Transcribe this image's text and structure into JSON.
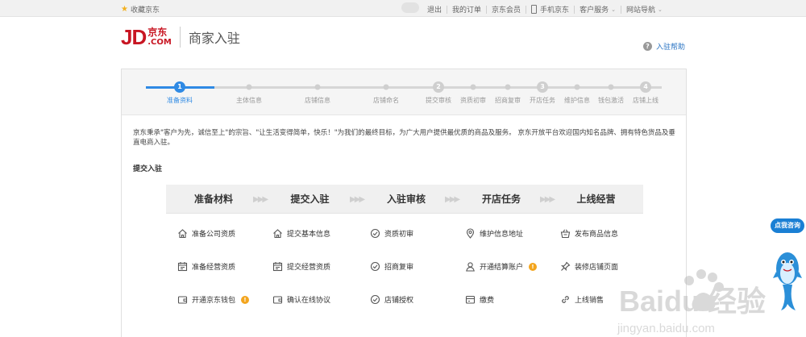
{
  "topbar": {
    "favorite": "收藏京东",
    "links": [
      "退出",
      "我的订单",
      "京东会员",
      "手机京东",
      "客户服务",
      "网站导航"
    ]
  },
  "header": {
    "logo_jd": "JD",
    "logo_cn": "京东",
    "logo_com": ".COM",
    "title": "商家入驻",
    "help": "入驻帮助"
  },
  "steps": {
    "labels": [
      "准备资料",
      "主体信息",
      "店铺信息",
      "店铺命名",
      "提交审核",
      "资质初审",
      "招商复审",
      "开店任务",
      "维护信息",
      "钱包激活",
      "店铺上线"
    ],
    "numbers": [
      "1",
      "2",
      "3",
      "4"
    ],
    "active_color": "#2f8ae4"
  },
  "intro": "京东秉承\"客户为先，诚信至上\"的宗旨、\"让生活变得简单，快乐！\"为我们的最终目标，为广大用户提供最优质的商品及服务。 京东开放平台欢迎国内知名品牌、拥有特色货品及垂直电商入驻。",
  "section_title": "提交入驻",
  "flow": {
    "columns": [
      {
        "title": "准备材料",
        "items": [
          {
            "label": "准备公司资质",
            "icon": "home-icon"
          },
          {
            "label": "准备经营资质",
            "icon": "calendar-icon"
          },
          {
            "label": "开通京东钱包",
            "icon": "wallet-icon",
            "badge": "!"
          }
        ]
      },
      {
        "title": "提交入驻",
        "items": [
          {
            "label": "提交基本信息",
            "icon": "home-icon"
          },
          {
            "label": "提交经营资质",
            "icon": "calendar-icon"
          },
          {
            "label": "确认在线协议",
            "icon": "wallet-icon"
          }
        ]
      },
      {
        "title": "入驻审核",
        "items": [
          {
            "label": "资质初审",
            "icon": "check-circle-icon"
          },
          {
            "label": "招商复审",
            "icon": "check-circle-icon"
          },
          {
            "label": "店铺授权",
            "icon": "check-circle-icon"
          }
        ]
      },
      {
        "title": "开店任务",
        "items": [
          {
            "label": "维护信息地址",
            "icon": "location-icon"
          },
          {
            "label": "开通结算账户",
            "icon": "user-icon",
            "badge": "!"
          },
          {
            "label": "缴费",
            "icon": "payment-icon"
          }
        ]
      },
      {
        "title": "上线经营",
        "items": [
          {
            "label": "发布商品信息",
            "icon": "basket-icon"
          },
          {
            "label": "装修店铺页面",
            "icon": "pin-icon"
          },
          {
            "label": "上线销售",
            "icon": "link-icon"
          }
        ]
      }
    ]
  },
  "service": {
    "label": "点我咨询"
  },
  "watermark": {
    "brand": "Baidu 经验",
    "url": "jingyan.baidu.com"
  }
}
